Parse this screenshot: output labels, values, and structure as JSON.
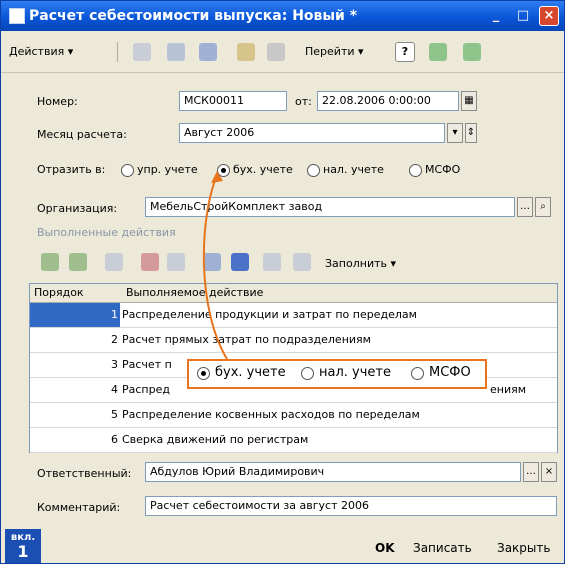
{
  "window": {
    "title": "Расчет себестоимости выпуска: Новый *",
    "minimize": "_",
    "maximize": "□",
    "close": "×"
  },
  "toolbar": {
    "actions": "Действия ▾",
    "goto": "Перейти ▾",
    "help": "?"
  },
  "form": {
    "number_label": "Номер:",
    "number_value": "МСК00011",
    "from_label": "от:",
    "date_value": "22.08.2006 0:00:00",
    "month_label": "Месяц расчета:",
    "month_value": "Август 2006",
    "reflect_label": "Отразить в:",
    "reflect_options": [
      "упр. учете",
      "бух. учете",
      "нал. учете",
      "МСФО"
    ],
    "org_label": "Организация:",
    "org_value": "МебельСтройКомплект завод"
  },
  "actions_section": {
    "title": "Выполненные действия",
    "fill_button": "Заполнить ▾"
  },
  "table": {
    "headers": [
      "Порядок",
      "Выполняемое действие"
    ],
    "rows": [
      {
        "num": "1",
        "action": "Распределение продукции и затрат по переделам"
      },
      {
        "num": "2",
        "action": "Расчет прямых затрат по подразделениям"
      },
      {
        "num": "3",
        "action": "Расчет п"
      },
      {
        "num": "4",
        "action": "Распред"
      },
      {
        "num": "5",
        "action": "Распределение косвенных расходов по переделам"
      },
      {
        "num": "6",
        "action": "Сверка движений по регистрам"
      }
    ],
    "row4_tail": "ениям"
  },
  "popup": {
    "options": [
      "бух. учете",
      "нал. учете",
      "МСФО"
    ]
  },
  "footer": {
    "responsible_label": "Ответственный:",
    "responsible_value": "Абдулов Юрий Владимирович",
    "comment_label": "Комментарий:",
    "comment_value": "Расчет себестоимости за август 2006",
    "badge_top": "вкл.",
    "badge_num": "1",
    "ok": "OK",
    "save": "Записать",
    "close": "Закрыть"
  },
  "colors": {
    "titlebar": "#0a56d8",
    "selection": "#316ac5",
    "callout": "#e8751d"
  }
}
